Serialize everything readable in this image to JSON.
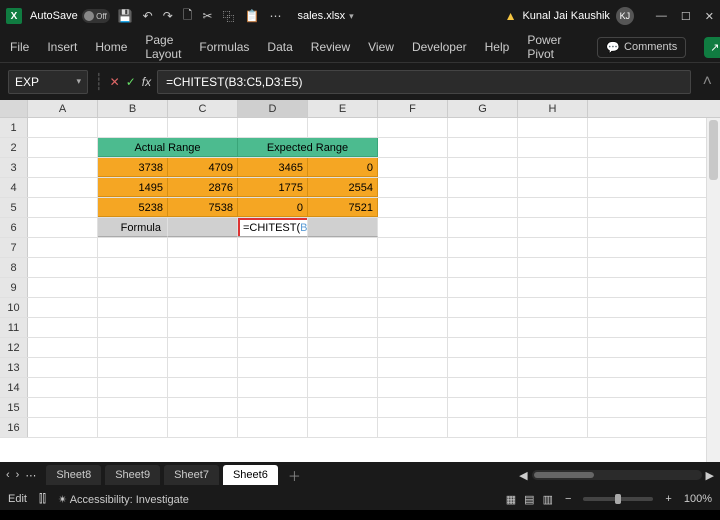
{
  "titlebar": {
    "app_initial": "X",
    "autosave_label": "AutoSave",
    "autosave_state": "Off",
    "filename": "sales.xlsx",
    "user_name": "Kunal Jai Kaushik",
    "user_initials": "KJ"
  },
  "qat": {
    "save": "💾",
    "undo": "↶",
    "redo": "↷",
    "newfile": "🗋",
    "cut": "✂",
    "copy": "⿻",
    "paste": "📋",
    "more": "⋯"
  },
  "winbtns": {
    "min": "—",
    "max": "☐",
    "close": "✕"
  },
  "ribbon": {
    "tabs": [
      "File",
      "Insert",
      "Home",
      "Page Layout",
      "Formulas",
      "Data",
      "Review",
      "View",
      "Developer",
      "Help",
      "Power Pivot"
    ],
    "comments_label": "Comments",
    "share_label": "↗"
  },
  "formulabar": {
    "namebox": "EXP",
    "fx_label": "fx",
    "formula_text": "=CHITEST(B3:C5,D3:E5)"
  },
  "columns": [
    "A",
    "B",
    "C",
    "D",
    "E",
    "F",
    "G",
    "H"
  ],
  "headers": {
    "actual": "Actual Range",
    "expected": "Expected Range"
  },
  "grid": [
    {
      "b": "3738",
      "c": "4709",
      "d": "3465",
      "e": "0"
    },
    {
      "b": "1495",
      "c": "2876",
      "d": "1775",
      "e": "2554"
    },
    {
      "b": "5238",
      "c": "7538",
      "d": "0",
      "e": "7521"
    }
  ],
  "formula_row": {
    "label": "Formula",
    "prefix": "=CHITEST(",
    "range1": "B3:C5",
    "comma": ",",
    "range2": "D3:E5",
    "suffix": ")"
  },
  "sheet_tabs": [
    "Sheet8",
    "Sheet9",
    "Sheet7",
    "Sheet6"
  ],
  "active_tab_index": 3,
  "status": {
    "mode": "Edit",
    "accessibility": "Accessibility: Investigate",
    "zoom": "100%"
  }
}
